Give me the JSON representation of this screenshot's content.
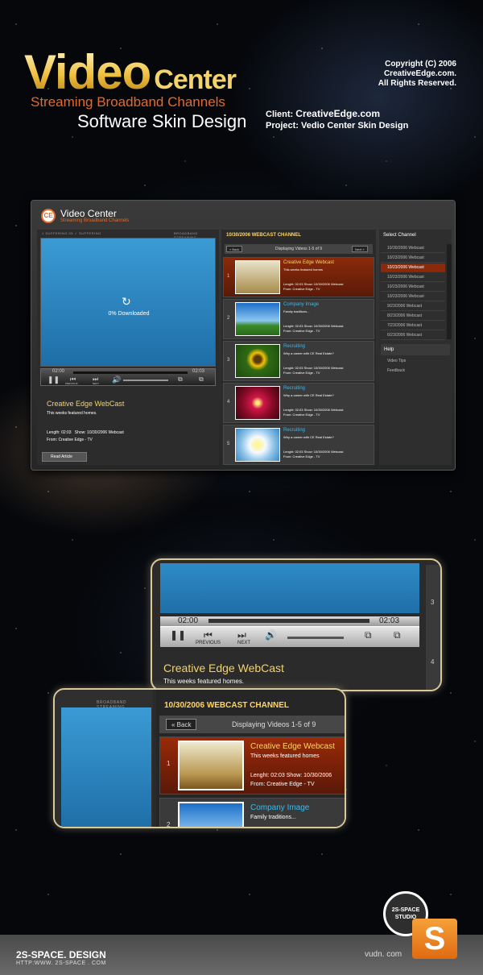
{
  "header": {
    "logo_main": "Video",
    "logo_center": "Center",
    "tagline": "Streaming Broadband Channels",
    "subtitle": "Software Skin Design",
    "copyright_line1": "Copyright (C) 2006 CreativeEdge.com.",
    "copyright_line2": "All Rights Reserved.",
    "client_label": "Client:",
    "client_value": "CreativeEdge.com",
    "project_label": "Project:",
    "project_value": "Vedio Center Skin  Design"
  },
  "player": {
    "title": "Video Center",
    "subtitle": "Streaming Broadband Channels",
    "logo_badge": "CE",
    "buffer_status": "1 SUFFERING  05 ✓ SUFFERING",
    "broadband_label": "BROADBAND STREAMING",
    "download_text": "0% Downloaded",
    "time_start": "02:00",
    "time_end": "02:03",
    "prev_label": "PREVIOUS",
    "next_label": "NEXT",
    "video_title": "Creative Edge WebCast",
    "video_desc": "This weeks featured homes.",
    "length": "Length: 02:03",
    "show": "Show: 10/30/2006 Webcast",
    "from": "From: Creative Edge - TV",
    "read_article": "Read Article"
  },
  "channel": {
    "heading": "10/30/2006 WEBCAST CHANNEL",
    "back": "« Back",
    "next": "Next »",
    "displaying": "Displaying Videos  1-5 of 9",
    "items": [
      {
        "n": "1",
        "title": "Creative Edge Webcast",
        "desc": "This weeks featured homes",
        "meta": "Lenght: 02:03     Show: 10/30/2006 Webcast",
        "from": "From: Creative Edge - TV"
      },
      {
        "n": "2",
        "title": "Company Image",
        "desc": "Family traditions...",
        "meta": "Lenght: 02:03     Show: 10/30/2006 Webcast",
        "from": "From: Creative Edge - TV"
      },
      {
        "n": "3",
        "title": "Recruiting",
        "desc": "Why a career with CE Real Estate?",
        "meta": "Lenght: 02:03     Show: 10/30/2006 Webcast",
        "from": "From: Creative Edge - TV"
      },
      {
        "n": "4",
        "title": "Recruiting",
        "desc": "Why a career with CE Real Estate?",
        "meta": "Lenght: 02:03     Show: 10/30/2006 Webcast",
        "from": "From: Creative Edge - TV"
      },
      {
        "n": "5",
        "title": "Recruiting",
        "desc": "Why a career with CE Real Estate?",
        "meta": "Lenght: 02:03     Show: 10/30/2006 Webcast",
        "from": "From: Creative Edge - TV"
      }
    ]
  },
  "sidebar": {
    "select_channel": "Select Channel",
    "channels": [
      "10/30/2006 Webcast",
      "10/23/2006 Webcast",
      "10/23/2006 Webcast",
      "10/23/2006 Webcast",
      "10/23/2006 Webcast",
      "10/23/2006 Webcast",
      "9/23/2006 Webcast",
      "8/23/2006 Webcast",
      "7/23/2006 Webcast",
      "6/23/2006 Webcast"
    ],
    "selected_index": 2,
    "help": "Help",
    "help_items": [
      "Video Tips",
      "Feedback"
    ]
  },
  "zoom1": {
    "time_start": "02:00",
    "time_end": "02:03",
    "prev_label": "PREVIOUS",
    "next_label": "NEXT",
    "title": "Creative Edge WebCast",
    "desc": "This weeks featured homes.",
    "side_numbers": [
      "3",
      "4"
    ]
  },
  "zoom2": {
    "broadband_label": "BROADBAND STREAMING",
    "heading": "10/30/2006 WEBCAST CHANNEL",
    "back": "« Back",
    "displaying": "Displaying Videos  1-5 of 9",
    "item1": {
      "n": "1",
      "title": "Creative Edge Webcast",
      "desc": "This weeks featured homes",
      "meta": "Lenght: 02:03     Show: 10/30/2006",
      "from": "From: Creative Edge - TV"
    },
    "item2": {
      "n": "2",
      "title": "Company Image",
      "desc": "Family traditions..."
    }
  },
  "footer": {
    "brand": "2S-SPACE. DESIGN",
    "url": "HTTP:WWW. 2S-SPACE . COM",
    "vudn": "vudn. com",
    "stamp_line1": "2S-SPACE",
    "stamp_line2": "STUDIO"
  },
  "colors": {
    "accent": "#f3d36a",
    "orange": "#e46a2a",
    "link": "#3fb8e6",
    "selected": "#8a2a0a"
  }
}
